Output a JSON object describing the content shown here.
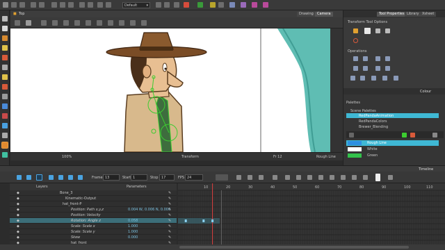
{
  "toolbar": {
    "workspace_select": "Default"
  },
  "viewer": {
    "view_title": "Top",
    "tabs": [
      "Drawing",
      "Camera"
    ],
    "active_tab": "Camera",
    "zoom": "100%",
    "transform_label": "Transform",
    "frame_status": "Fr 12",
    "rough_line": "Rough Line"
  },
  "tool_properties": {
    "tabs": [
      "Tool Properties",
      "Library",
      "Xsheet"
    ],
    "active_tab": "Tool Properties",
    "section_transform": "Transform Tool Options",
    "section_operations": "Operations"
  },
  "colour": {
    "title": "Colour",
    "palettes_label": "Palettes",
    "palette_items": [
      "Scene Palettes",
      "RedPandaAnimation",
      "RedPandaColors",
      "Brewer_Blending"
    ],
    "selected_palette": "RedPandaAnimation",
    "swatches": [
      {
        "name": "Rough Line",
        "color": "#2e8fe0"
      },
      {
        "name": "White",
        "color": "#ffffff"
      },
      {
        "name": "Green",
        "color": "#33c24b"
      }
    ]
  },
  "timeline": {
    "title": "Timeline",
    "frame_label": "Frame",
    "frame_value": "13",
    "start_label": "Start",
    "start_value": "1",
    "stop_label": "Stop",
    "stop_value": "17",
    "fps_label": "FPS",
    "fps_value": "24",
    "layers_header": "Layers",
    "params_header": "Parameters",
    "frame_ticks": [
      "10",
      "20",
      "30",
      "40",
      "50",
      "60",
      "70",
      "80",
      "90",
      "100",
      "110"
    ],
    "rows": [
      {
        "name": "Bone_3",
        "value": ""
      },
      {
        "name": "Kinematic-Output",
        "value": ""
      },
      {
        "name": "hat_front-P",
        "value": ""
      },
      {
        "name": "Position: Path x,y,z",
        "value": "0.004 W, 0.006 N, 0.000"
      },
      {
        "name": "Position: Velocity",
        "value": ""
      },
      {
        "name": "Rotation: Angle z",
        "value": "0.058"
      },
      {
        "name": "Scale: Scale x",
        "value": "1.000"
      },
      {
        "name": "Scale: Scale y",
        "value": "1.000"
      },
      {
        "name": "Skew",
        "value": "0.000"
      },
      {
        "name": "hat_front",
        "value": ""
      }
    ],
    "selected_row": 5
  },
  "colors": {
    "accent": "#4aa3c0",
    "selection": "#3c6e79",
    "curtain": "#5fbdb3",
    "guide_green": "#3ccc30"
  }
}
